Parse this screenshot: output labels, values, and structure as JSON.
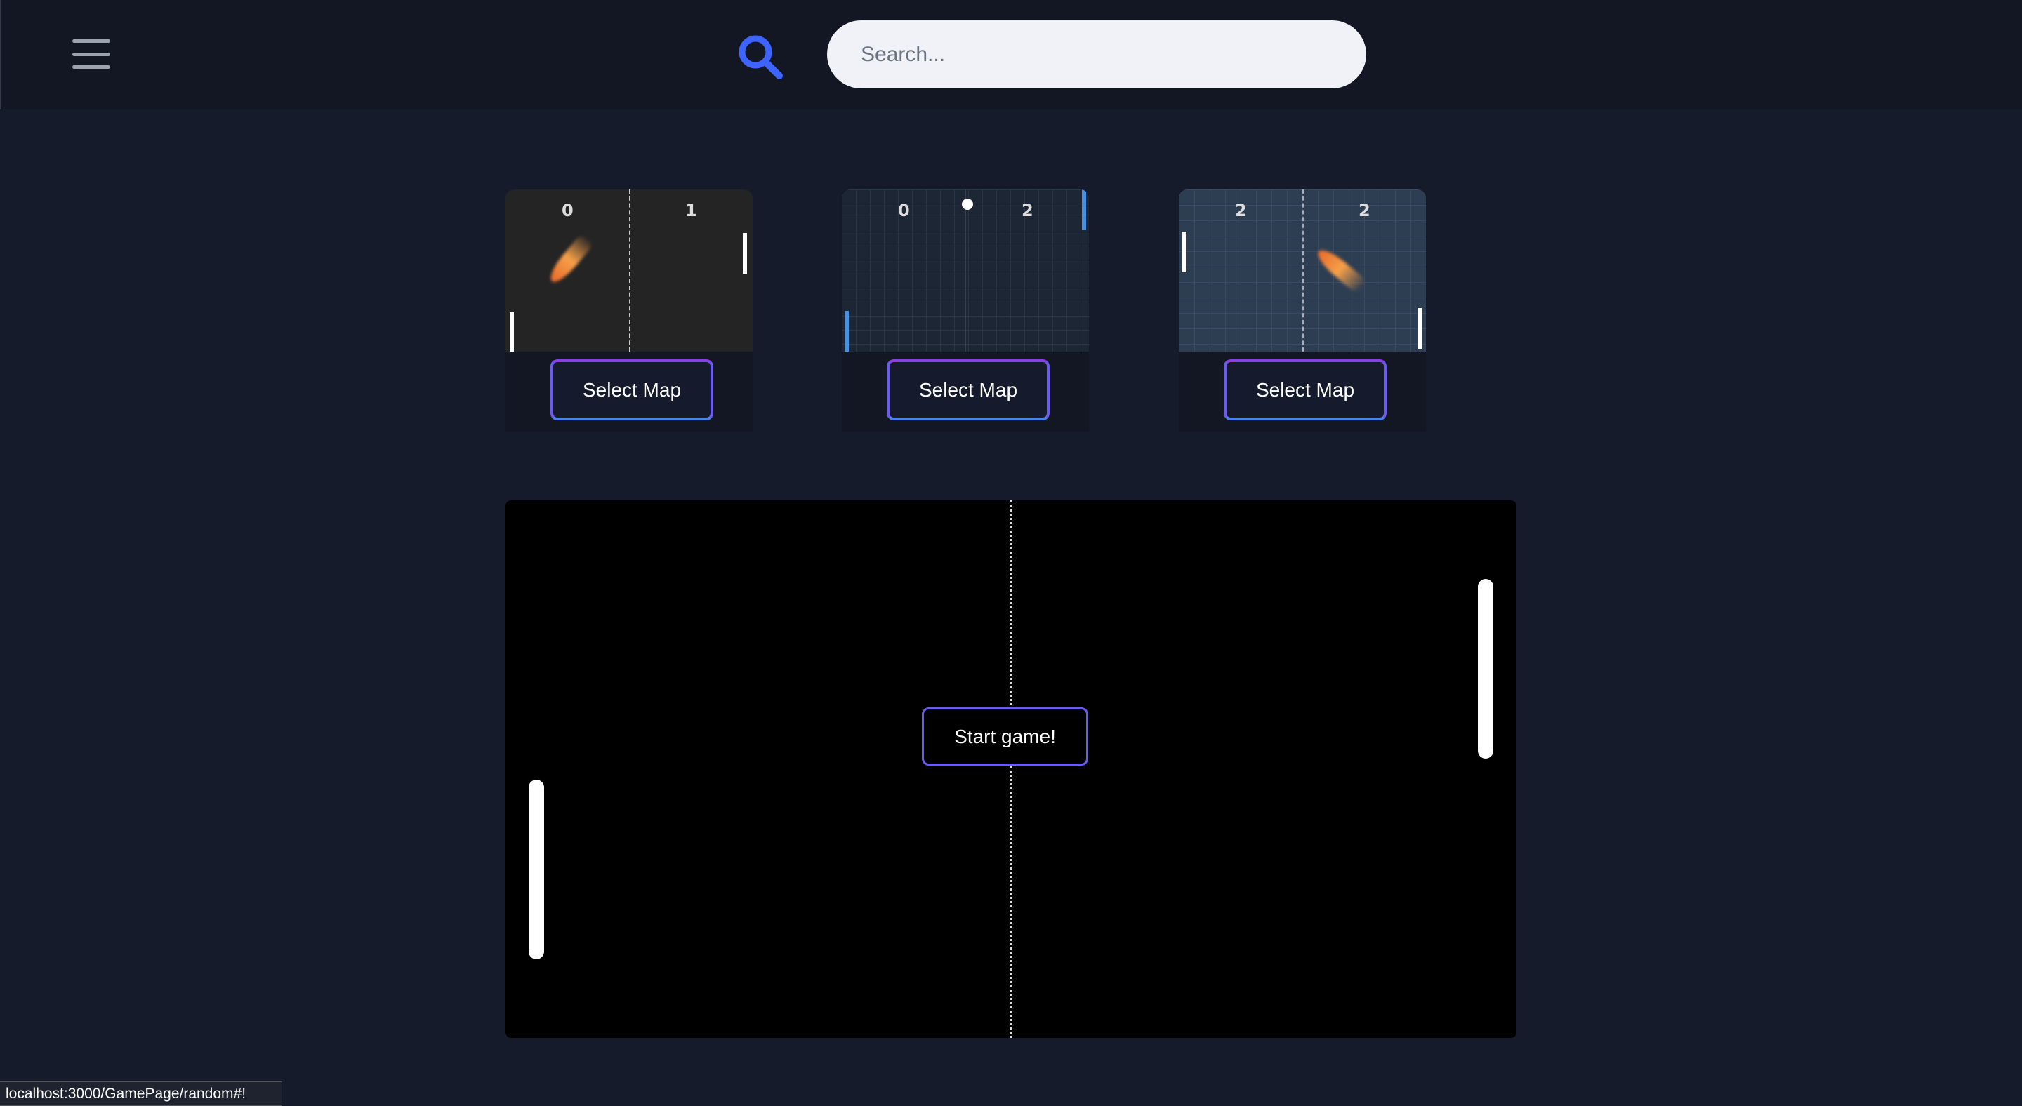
{
  "header": {
    "menu_icon": "hamburger-icon",
    "search_icon": "search-icon",
    "search_placeholder": "Search...",
    "search_value": "",
    "accent": "#3e64ff"
  },
  "maps": [
    {
      "theme": "classic-dark",
      "score_left": "0",
      "score_right": "1",
      "button": "Select Map"
    },
    {
      "theme": "grid-dark",
      "score_left": "0",
      "score_right": "2",
      "button": "Select Map"
    },
    {
      "theme": "grid-slate",
      "score_left": "2",
      "score_right": "2",
      "button": "Select Map"
    }
  ],
  "game": {
    "start_label": "Start game!"
  },
  "status_bar": {
    "url": "localhost:3000/GamePage/random#!"
  }
}
